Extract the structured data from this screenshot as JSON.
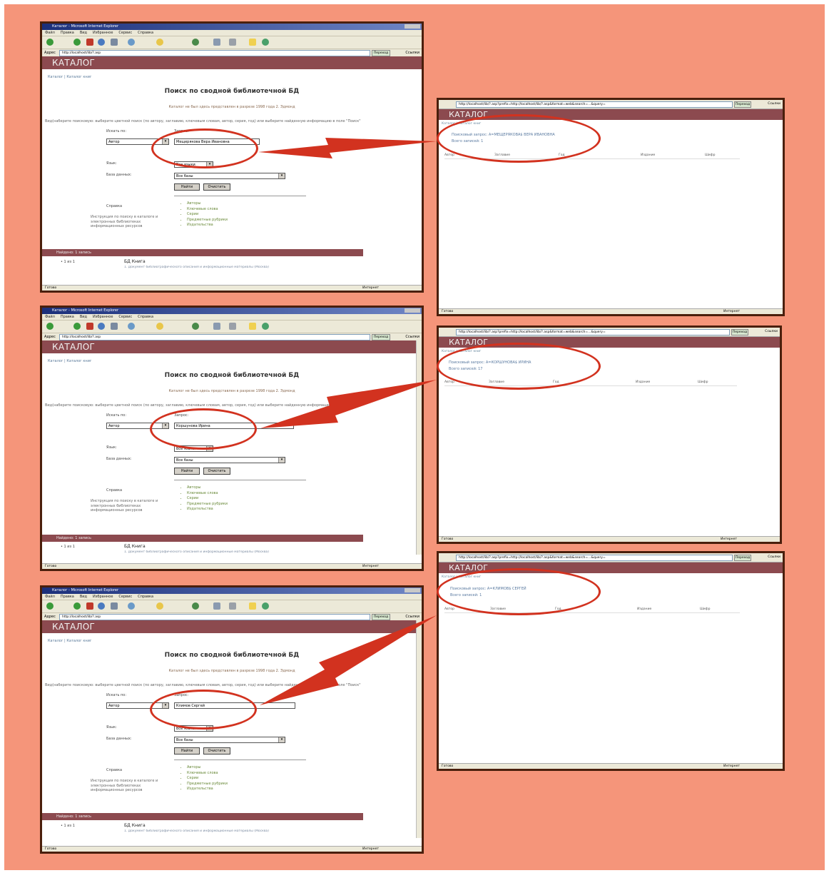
{
  "browser": {
    "title": "Каталог - Microsoft Internet Explorer",
    "menu": [
      "Файл",
      "Правка",
      "Вид",
      "Избранное",
      "Сервис",
      "Справка"
    ],
    "address_label": "Адрес",
    "url": "http://localhost/lib/?.asp",
    "go_label": "Переход",
    "links_label": "Ссылки",
    "status_done": "Готово",
    "status_zone": "Интернет"
  },
  "result_browser": {
    "url": "http://localhost/lib/?.asp?prefix=http://localhost/lib/?.asp&format=web&search=...&query=",
    "go_label": "Переход",
    "links_label": "Ссылки"
  },
  "catalog": {
    "header": "КАТАЛОГ",
    "breadcrumb": "Каталог | Каталог книг",
    "page_title": "Поиск по сводной библиотечной БД",
    "hint": "Каталог не был здесь представлен в разрезе 1998 года 2. Эдмонд",
    "instruction": "Вид(наберите поисковую: выберите цветной поиск (по автору, заглавию, ключевым словам, автор, серия, год) или выберите найденную информацию в поле \"Поиск\"",
    "field_label": "Искать по:",
    "query_label": "Запрос:",
    "lang_label": "Язык:",
    "lang_value": "Все языки",
    "base_label": "База данных:",
    "base_value": "Все базы",
    "find_button": "Найти",
    "clear_button": "Очистить",
    "help_label": "Справка",
    "help_note": "Инструкция по поиску в каталоге и электронных библиотеках информационных ресурсов",
    "help_links": [
      "Авторы",
      "Ключевые слова",
      "Серии",
      "Предметные рубрики",
      "Издательства"
    ],
    "results_bar": "Найдено: 1 запись",
    "result_item": "• 1 из 1",
    "result_db": "БД Книга",
    "result_desc": "1. Документ библиографического описания и информационные материалы (Москва)",
    "columns": [
      "Автор",
      "Заглавие",
      "Год",
      "Издание",
      "Шифр"
    ]
  },
  "searches": [
    {
      "field": "Автор",
      "query": "Мещерякова Вера Ивановна"
    },
    {
      "field": "Автор",
      "query": "Коршунова Ирина"
    },
    {
      "field": "Автор",
      "query": "Климов Сергей"
    }
  ],
  "results": [
    {
      "query_line": "Поисковый запрос: А=МЕЩЕРЯКОВА$ ВЕРА ИВАНОВНА",
      "count_line": "Всего записей: 1"
    },
    {
      "query_line": "Поисковый запрос: А=КОРШУНОВА$ ИРИНА",
      "count_line": "Всего записей: 17"
    },
    {
      "query_line": "Поисковый запрос: А=КЛИМОВ$ СЕРГЕЙ",
      "count_line": "Всего записей: 1"
    }
  ],
  "colors": {
    "background": "#f5957a",
    "header": "#8c4a4f",
    "highlight": "#d2321f",
    "frame": "#4a1f0c"
  }
}
